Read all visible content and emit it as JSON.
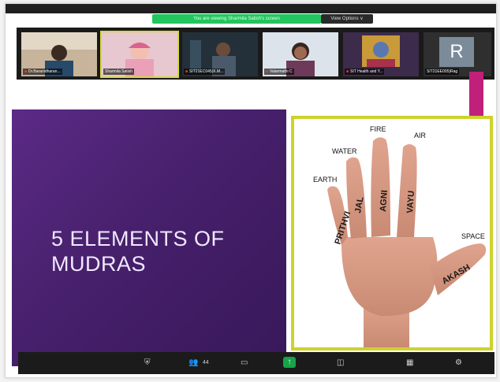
{
  "banner": {
    "text": "You are viewing Sharmila Satish's screen",
    "view_options": "View Options ∨"
  },
  "participants": [
    {
      "name": "Dr.Baranidharan..."
    },
    {
      "name": "Sharmila Satish"
    },
    {
      "name": "SIT21EC045(K.M..."
    },
    {
      "name": "Valarmathi C"
    },
    {
      "name": "SIT Health and Y..."
    },
    {
      "name": "SIT21EE005)Rag",
      "initial": "R"
    }
  ],
  "slide": {
    "title_line1": "5 ELEMENTS OF",
    "title_line2": "MUDRAS",
    "labels_top": {
      "space": "SPACE",
      "air": "AIR",
      "fire": "FIRE",
      "water": "WATER",
      "earth": "EARTH"
    },
    "labels_finger": {
      "akash": "AKASH",
      "vayu": "VAYU",
      "agni": "AGNI",
      "jal": "JAL",
      "prithvi": "PRITHVI"
    }
  },
  "toolbar": {
    "participants_count": "44"
  },
  "colors": {
    "slide_bg": "#47206c",
    "accent_pink": "#c0207a",
    "border_yellow": "#cdd32b",
    "banner_green": "#22c55e"
  },
  "icons": [
    "shield-icon",
    "participants-icon",
    "chat-icon",
    "share-screen-icon",
    "record-icon",
    "reactions-icon",
    "apps-icon",
    "more-icon"
  ]
}
